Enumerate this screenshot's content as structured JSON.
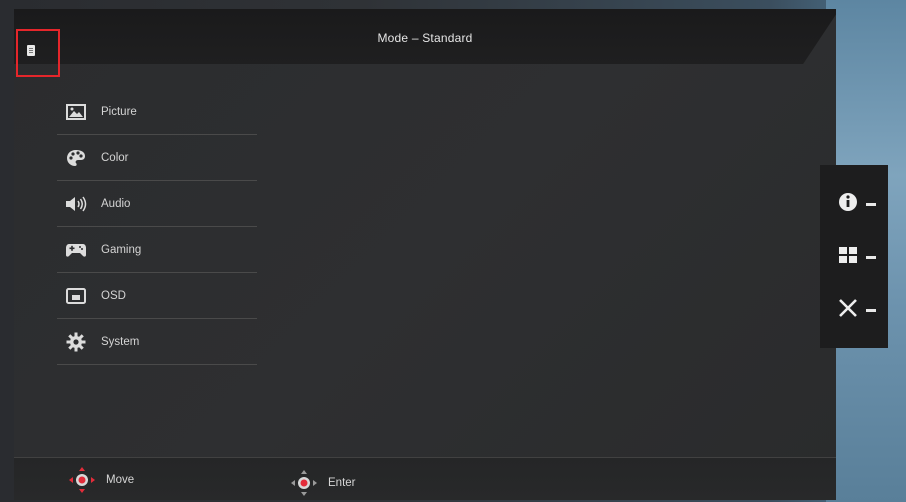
{
  "header": {
    "title": "Mode – Standard"
  },
  "menu": {
    "items": [
      {
        "label": "Picture",
        "icon": "picture-icon"
      },
      {
        "label": "Color",
        "icon": "palette-icon"
      },
      {
        "label": "Audio",
        "icon": "speaker-icon"
      },
      {
        "label": "Gaming",
        "icon": "gamepad-icon"
      },
      {
        "label": "OSD",
        "icon": "osd-icon"
      },
      {
        "label": "System",
        "icon": "gear-icon"
      }
    ]
  },
  "footer": {
    "move_label": "Move",
    "enter_label": "Enter"
  },
  "side_keys": [
    {
      "icon": "info-icon"
    },
    {
      "icon": "grid-icon"
    },
    {
      "icon": "close-icon"
    }
  ],
  "colors": {
    "highlight_box": "#e5262b",
    "dpad_accent": "#e32c3a"
  }
}
